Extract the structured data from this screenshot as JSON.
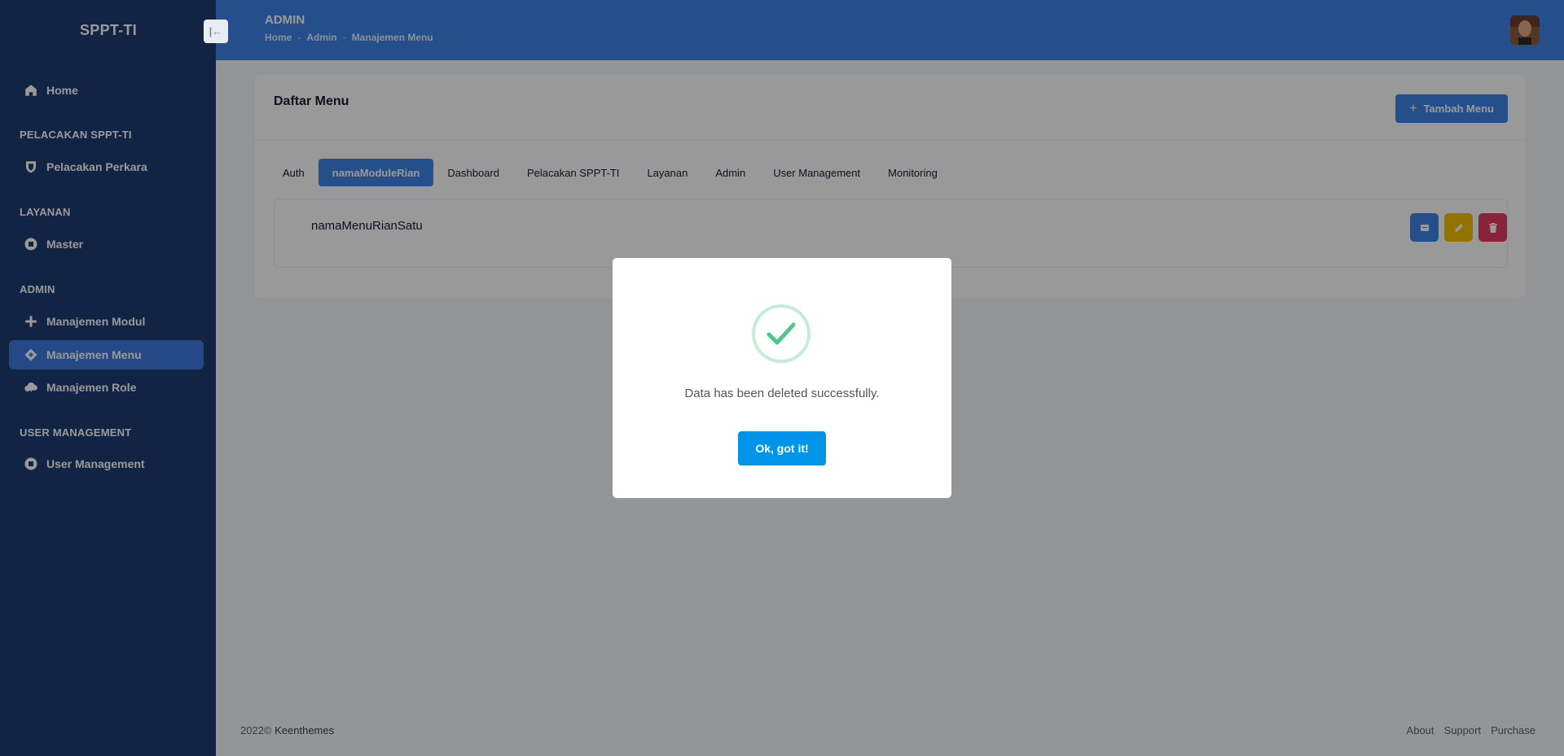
{
  "sidebar": {
    "brand": "SPPT-TI",
    "collapse_icon": "collapse-left-icon",
    "sections": [
      {
        "title": ""
      },
      {
        "title": "PELACAKAN SPPT-TI"
      },
      {
        "title": "LAYANAN"
      },
      {
        "title": "ADMIN"
      },
      {
        "title": "USER MANAGEMENT"
      }
    ],
    "items": [
      {
        "label": "Home",
        "icon": "home-icon"
      },
      {
        "label": "Pelacakan Perkara",
        "icon": "shield-icon"
      },
      {
        "label": "Master",
        "icon": "circle-square-icon"
      },
      {
        "label": "Manajemen Modul",
        "icon": "plus-icon"
      },
      {
        "label": "Manajemen Menu",
        "icon": "diamond-icon",
        "active": true
      },
      {
        "label": "Manajemen Role",
        "icon": "cloud-icon"
      },
      {
        "label": "User Management",
        "icon": "circle-square-icon"
      }
    ]
  },
  "header": {
    "title": "ADMIN",
    "breadcrumb": [
      "Home",
      "Admin",
      "Manajemen Menu"
    ],
    "separator": "-"
  },
  "main": {
    "title": "Daftar Menu",
    "add_button": "Tambah Menu",
    "tabs": [
      {
        "label": "Auth"
      },
      {
        "label": "namaModuleRian",
        "active": true
      },
      {
        "label": "Dashboard"
      },
      {
        "label": "Pelacakan SPPT-TI"
      },
      {
        "label": "Layanan"
      },
      {
        "label": "Admin"
      },
      {
        "label": "User Management"
      },
      {
        "label": "Monitoring"
      }
    ],
    "menu_items": [
      {
        "name": "namaMenuRianSatu"
      }
    ]
  },
  "footer": {
    "year": "2022©",
    "company": "Keenthemes",
    "links": [
      "About",
      "Support",
      "Purchase"
    ]
  },
  "modal": {
    "message": "Data has been deleted successfully.",
    "button": "Ok, got it!",
    "icon": "success-check-icon"
  },
  "colors": {
    "sidebar_bg": "#1e3d72",
    "header_bg": "#3e84e6",
    "primary": "#3e84e6",
    "warning": "#f5c000",
    "danger": "#e43a63",
    "success": "#4cc98a",
    "modal_button": "#0095e8"
  }
}
